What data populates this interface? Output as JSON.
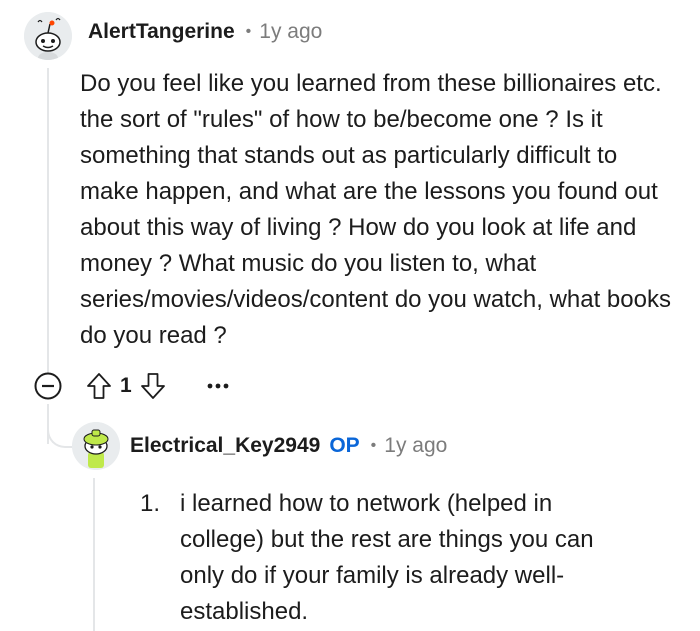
{
  "comment": {
    "username": "AlertTangerine",
    "separator": "•",
    "time": "1y ago",
    "body": "Do you feel like you learned from these billionaires etc. the sort of \"rules\" of how to be/become one ? Is it something that stands out as particularly difficult to make happen, and what are the lessons you found out about this way of living ? How do you look at life and money ? What music do you listen to, what series/movies/videos/content do you watch, what books do you read ?",
    "vote_count": "1",
    "icons": {
      "collapse": "collapse-minus-icon",
      "upvote": "upvote-arrow-icon",
      "downvote": "downvote-arrow-icon",
      "more": "more-dots-icon"
    }
  },
  "reply": {
    "username": "Electrical_Key2949",
    "op_badge": "OP",
    "separator": "•",
    "time": "1y ago",
    "list_number": "1.",
    "body": "i learned how to network (helped in college) but the rest are things you can only do if your family is already well-established."
  },
  "colors": {
    "text": "#1c1c1c",
    "meta": "#7c7c7c",
    "op_blue": "#0a66d8",
    "thread_line": "#e4e6e8",
    "avatar_green": "#bfe94a"
  }
}
